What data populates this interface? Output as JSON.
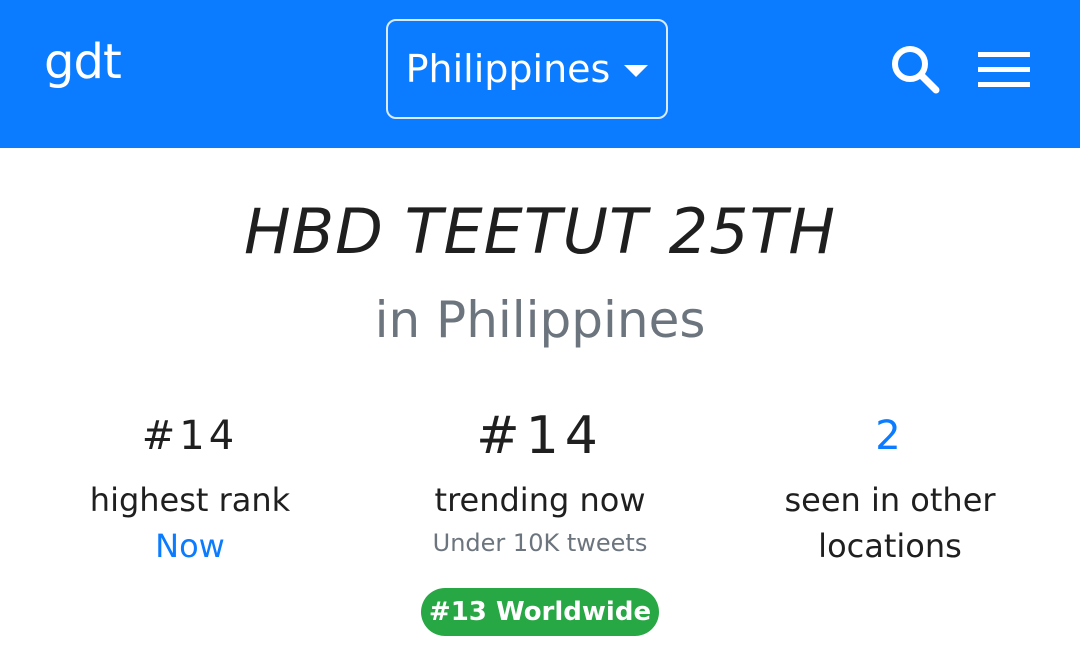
{
  "header": {
    "logo": "gdt",
    "country_select": {
      "selected": "Philippines"
    },
    "icons": {
      "search": "search-icon",
      "menu": "menu-icon"
    },
    "colors": {
      "bar": "#0b7cff"
    }
  },
  "trend": {
    "title": "HBD TEETUT 25TH",
    "location": "in Philippines"
  },
  "stats": {
    "highest_rank": {
      "value": "#14",
      "label": "highest rank",
      "sub": "Now"
    },
    "trending_now": {
      "value": "#14",
      "label": "trending now",
      "sub": "Under 10K tweets"
    },
    "other_locations": {
      "value": "2",
      "label": "seen in other locations"
    }
  },
  "worldwide_badge": {
    "label": "#13 Worldwide",
    "color": "#28a745"
  }
}
